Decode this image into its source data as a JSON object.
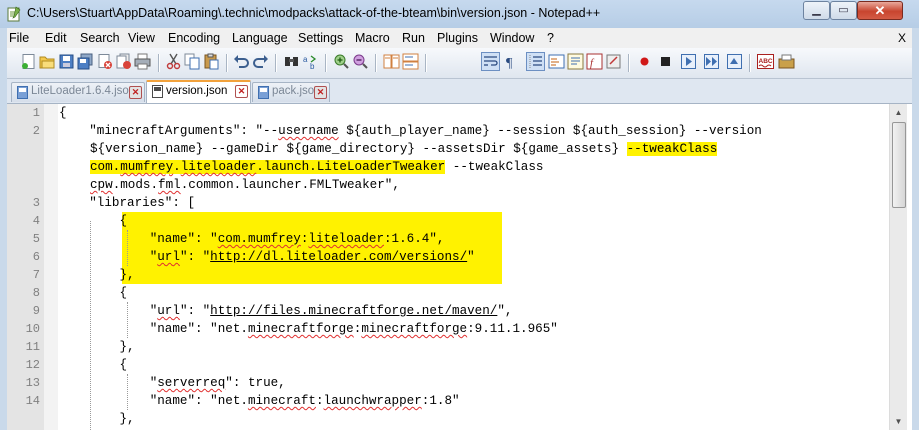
{
  "window": {
    "title": "C:\\Users\\Stuart\\AppData\\Roaming\\.technic\\modpacks\\attack-of-the-bteam\\bin\\version.json - Notepad++",
    "minimize_icon": "minimize-icon",
    "maximize_icon": "maximize-icon",
    "close_icon": "close-icon",
    "min_glyph": "▁",
    "max_glyph": "▭",
    "close_glyph": "✕"
  },
  "menu": {
    "items": [
      "File",
      "Edit",
      "Search",
      "View",
      "Encoding",
      "Language",
      "Settings",
      "Macro",
      "Run",
      "Plugins",
      "Window",
      "?"
    ],
    "close_doc": "X"
  },
  "tabs": [
    {
      "label": "LiteLoader1.6.4.json",
      "active": false
    },
    {
      "label": "version.json",
      "active": true
    },
    {
      "label": "pack.json",
      "active": false
    }
  ],
  "tab_close_glyph": "✕",
  "editor": {
    "line_numbers": [
      "1",
      "2",
      "",
      "",
      "",
      "3",
      "4",
      "5",
      "6",
      "7",
      "8",
      "9",
      "10",
      "11",
      "12",
      "13",
      "14",
      ""
    ],
    "lines": {
      "l1": "{",
      "l2a": "    \"minecraftArguments\": \"--",
      "l2a_sq": "username",
      "l2b": " ${auth_player_name} --session ${auth_session} --version",
      "l2c": "${version_name} --gameDir ${game_directory} --assetsDir ${game_assets} ",
      "l2c_hl": "--tweakClass",
      "l2d_hl_a": "com.",
      "l2d_hl_sq1": "mumfrey",
      "l2d_hl_b": ".",
      "l2d_hl_sq2": "liteloader",
      "l2d_hl_c": ".launch.LiteLoaderTweaker",
      "l2d": " --tweakClass",
      "l2e_sq1": "cpw",
      "l2e_a": ".mods.",
      "l2e_sq2": "fml",
      "l2e_b": ".common.launcher.FMLTweaker\",",
      "l3": "    \"libraries\": [",
      "l4": "        {",
      "l5a": "            \"name\": \"",
      "l5_sq1": "com.mumfrey",
      "l5b": ":",
      "l5_sq2": "liteloader",
      "l5c": ":1.6.4\",",
      "l6a": "            \"",
      "l6_sq": "url",
      "l6b": "\": \"",
      "l6_link": "http://dl.liteloader.com/versions/",
      "l6c": "\"",
      "l7": "        },",
      "l8": "        {",
      "l9a": "            \"",
      "l9_sq": "url",
      "l9b": "\": \"",
      "l9_link": "http://files.minecraftforge.net/maven/",
      "l9c": "\",",
      "l10a": "            \"name\": \"net.",
      "l10_sq1": "minecraftforge",
      "l10b": ":",
      "l10_sq2": "minecraftforge",
      "l10c": ":9.11.1.965\"",
      "l11": "        },",
      "l12": "        {",
      "l13a": "            \"",
      "l13_sq": "serverreq",
      "l13b": "\": true,",
      "l14a": "            \"name\": \"net.",
      "l14_sq1": "minecraft",
      "l14b": ":",
      "l14_sq2": "launchwrapper",
      "l14c": ":1.8\"",
      "l15": "        },"
    }
  },
  "scrollbar": {
    "up_glyph": "▲",
    "down_glyph": "▼"
  },
  "colors": {
    "highlight": "#fff200",
    "active_tab_accent": "#f2a23c",
    "gutter": "#e4e4e4"
  }
}
